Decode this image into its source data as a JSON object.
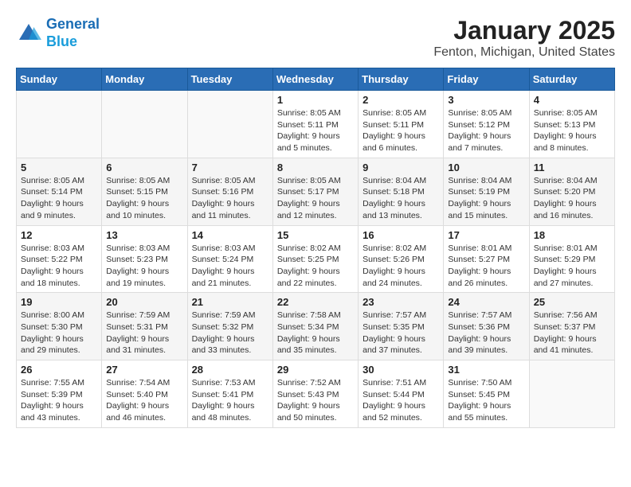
{
  "header": {
    "logo_line1": "General",
    "logo_line2": "Blue",
    "title": "January 2025",
    "subtitle": "Fenton, Michigan, United States"
  },
  "weekdays": [
    "Sunday",
    "Monday",
    "Tuesday",
    "Wednesday",
    "Thursday",
    "Friday",
    "Saturday"
  ],
  "weeks": [
    [
      {
        "day": "",
        "info": ""
      },
      {
        "day": "",
        "info": ""
      },
      {
        "day": "",
        "info": ""
      },
      {
        "day": "1",
        "info": "Sunrise: 8:05 AM\nSunset: 5:11 PM\nDaylight: 9 hours\nand 5 minutes."
      },
      {
        "day": "2",
        "info": "Sunrise: 8:05 AM\nSunset: 5:11 PM\nDaylight: 9 hours\nand 6 minutes."
      },
      {
        "day": "3",
        "info": "Sunrise: 8:05 AM\nSunset: 5:12 PM\nDaylight: 9 hours\nand 7 minutes."
      },
      {
        "day": "4",
        "info": "Sunrise: 8:05 AM\nSunset: 5:13 PM\nDaylight: 9 hours\nand 8 minutes."
      }
    ],
    [
      {
        "day": "5",
        "info": "Sunrise: 8:05 AM\nSunset: 5:14 PM\nDaylight: 9 hours\nand 9 minutes."
      },
      {
        "day": "6",
        "info": "Sunrise: 8:05 AM\nSunset: 5:15 PM\nDaylight: 9 hours\nand 10 minutes."
      },
      {
        "day": "7",
        "info": "Sunrise: 8:05 AM\nSunset: 5:16 PM\nDaylight: 9 hours\nand 11 minutes."
      },
      {
        "day": "8",
        "info": "Sunrise: 8:05 AM\nSunset: 5:17 PM\nDaylight: 9 hours\nand 12 minutes."
      },
      {
        "day": "9",
        "info": "Sunrise: 8:04 AM\nSunset: 5:18 PM\nDaylight: 9 hours\nand 13 minutes."
      },
      {
        "day": "10",
        "info": "Sunrise: 8:04 AM\nSunset: 5:19 PM\nDaylight: 9 hours\nand 15 minutes."
      },
      {
        "day": "11",
        "info": "Sunrise: 8:04 AM\nSunset: 5:20 PM\nDaylight: 9 hours\nand 16 minutes."
      }
    ],
    [
      {
        "day": "12",
        "info": "Sunrise: 8:03 AM\nSunset: 5:22 PM\nDaylight: 9 hours\nand 18 minutes."
      },
      {
        "day": "13",
        "info": "Sunrise: 8:03 AM\nSunset: 5:23 PM\nDaylight: 9 hours\nand 19 minutes."
      },
      {
        "day": "14",
        "info": "Sunrise: 8:03 AM\nSunset: 5:24 PM\nDaylight: 9 hours\nand 21 minutes."
      },
      {
        "day": "15",
        "info": "Sunrise: 8:02 AM\nSunset: 5:25 PM\nDaylight: 9 hours\nand 22 minutes."
      },
      {
        "day": "16",
        "info": "Sunrise: 8:02 AM\nSunset: 5:26 PM\nDaylight: 9 hours\nand 24 minutes."
      },
      {
        "day": "17",
        "info": "Sunrise: 8:01 AM\nSunset: 5:27 PM\nDaylight: 9 hours\nand 26 minutes."
      },
      {
        "day": "18",
        "info": "Sunrise: 8:01 AM\nSunset: 5:29 PM\nDaylight: 9 hours\nand 27 minutes."
      }
    ],
    [
      {
        "day": "19",
        "info": "Sunrise: 8:00 AM\nSunset: 5:30 PM\nDaylight: 9 hours\nand 29 minutes."
      },
      {
        "day": "20",
        "info": "Sunrise: 7:59 AM\nSunset: 5:31 PM\nDaylight: 9 hours\nand 31 minutes."
      },
      {
        "day": "21",
        "info": "Sunrise: 7:59 AM\nSunset: 5:32 PM\nDaylight: 9 hours\nand 33 minutes."
      },
      {
        "day": "22",
        "info": "Sunrise: 7:58 AM\nSunset: 5:34 PM\nDaylight: 9 hours\nand 35 minutes."
      },
      {
        "day": "23",
        "info": "Sunrise: 7:57 AM\nSunset: 5:35 PM\nDaylight: 9 hours\nand 37 minutes."
      },
      {
        "day": "24",
        "info": "Sunrise: 7:57 AM\nSunset: 5:36 PM\nDaylight: 9 hours\nand 39 minutes."
      },
      {
        "day": "25",
        "info": "Sunrise: 7:56 AM\nSunset: 5:37 PM\nDaylight: 9 hours\nand 41 minutes."
      }
    ],
    [
      {
        "day": "26",
        "info": "Sunrise: 7:55 AM\nSunset: 5:39 PM\nDaylight: 9 hours\nand 43 minutes."
      },
      {
        "day": "27",
        "info": "Sunrise: 7:54 AM\nSunset: 5:40 PM\nDaylight: 9 hours\nand 46 minutes."
      },
      {
        "day": "28",
        "info": "Sunrise: 7:53 AM\nSunset: 5:41 PM\nDaylight: 9 hours\nand 48 minutes."
      },
      {
        "day": "29",
        "info": "Sunrise: 7:52 AM\nSunset: 5:43 PM\nDaylight: 9 hours\nand 50 minutes."
      },
      {
        "day": "30",
        "info": "Sunrise: 7:51 AM\nSunset: 5:44 PM\nDaylight: 9 hours\nand 52 minutes."
      },
      {
        "day": "31",
        "info": "Sunrise: 7:50 AM\nSunset: 5:45 PM\nDaylight: 9 hours\nand 55 minutes."
      },
      {
        "day": "",
        "info": ""
      }
    ]
  ]
}
